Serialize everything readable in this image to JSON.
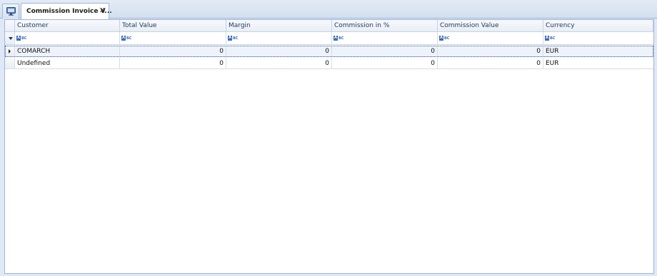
{
  "tabs": {
    "home_icon": "monitor-icon",
    "active_tab": {
      "label": "Commission Invoice V...",
      "close_glyph": "✕"
    }
  },
  "grid": {
    "columns": [
      "Customer",
      "Total Value",
      "Margin",
      "Commission in %",
      "Commission Value",
      "Currency"
    ],
    "filter_icon": "abc-filter-icon",
    "rows": [
      {
        "customer": "COMARCH",
        "total_value": "0",
        "margin": "0",
        "commission_pct": "0",
        "commission_value": "0",
        "currency": "EUR"
      },
      {
        "customer": "Undefined",
        "total_value": "0",
        "margin": "0",
        "commission_pct": "0",
        "commission_value": "0",
        "currency": "EUR"
      }
    ]
  },
  "colors": {
    "background": "#dfe8f6",
    "header_text": "#1e395b",
    "focus_row": "#eef3fb",
    "border": "#9fb5d6"
  }
}
